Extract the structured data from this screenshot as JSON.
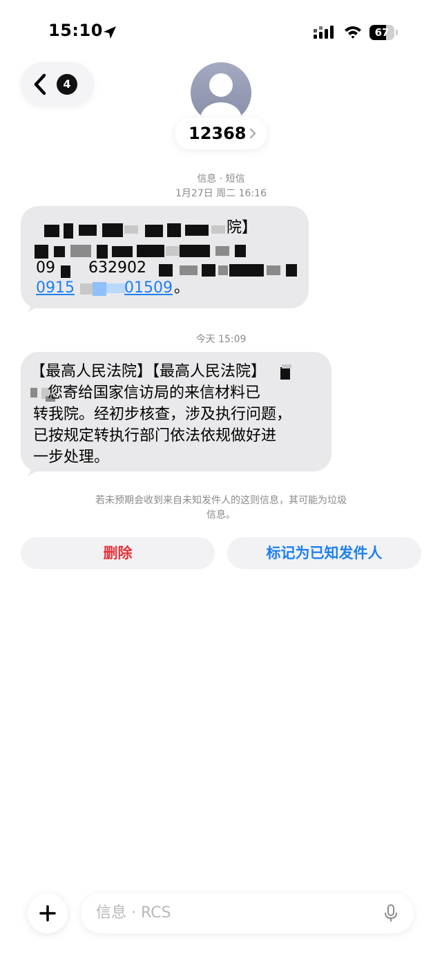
{
  "status_bar": {
    "time": "15:10",
    "battery_level": "67",
    "icons": [
      "location-arrow-icon",
      "cellular-signal-icon",
      "wifi-icon",
      "battery-icon"
    ]
  },
  "header": {
    "unread_count": "4",
    "contact_name": "12368",
    "icons": [
      "chevron-left-icon",
      "avatar-person-icon",
      "chevron-right-icon"
    ]
  },
  "conversation": {
    "service_label": "信息 · 短信",
    "first_timestamp": "1月27日 周二 16:16",
    "message1": {
      "line1_tail": "院】",
      "line3_start": "09",
      "line3_mid": "632902",
      "line4_link_start": "0915",
      "line4_link_end": "01509",
      "line4_end": "。"
    },
    "second_timestamp": "今天 15:09",
    "message2": {
      "line1": "【最高人民法院】【最高人民法院】",
      "line2": "   您寄给国家信访局的来信材料已",
      "line3": "转我院。经初步核查，涉及执行问题，",
      "line4": "已按规定转执行部门依法依规做好进",
      "line5": "一步处理。"
    }
  },
  "junk_notice": {
    "line1": "若未预期会收到来自未知发件人的这则信息，其可能为垃圾",
    "line2": "信息。"
  },
  "actions": {
    "delete_label": "删除",
    "mark_known_label": "标记为已知发件人",
    "colors": {
      "delete": "#e5343a",
      "mark_known": "#1d7ff2"
    }
  },
  "compose": {
    "placeholder": "信息 · RCS",
    "icons": [
      "plus-icon",
      "microphone-icon"
    ]
  }
}
